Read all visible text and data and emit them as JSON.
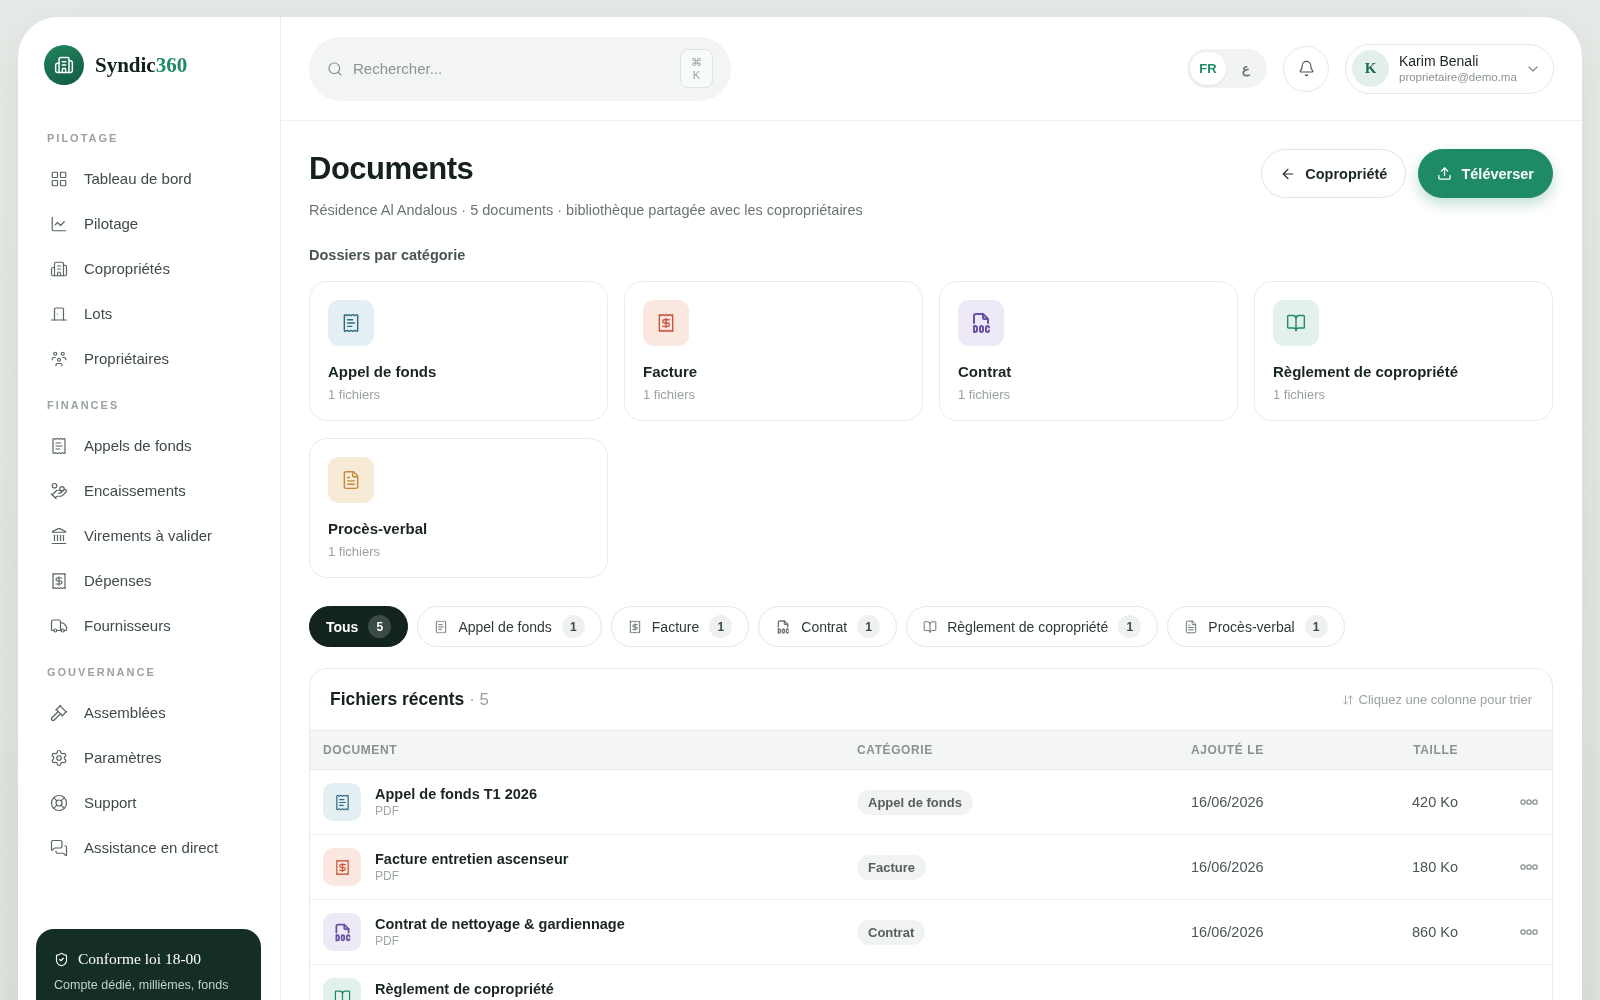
{
  "brand": {
    "name": "Syndic",
    "suffix": "360"
  },
  "sidebar": {
    "sections": [
      {
        "label": "PILOTAGE",
        "items": [
          {
            "label": "Tableau de bord"
          },
          {
            "label": "Pilotage"
          },
          {
            "label": "Copropriétés"
          },
          {
            "label": "Lots"
          },
          {
            "label": "Propriétaires"
          }
        ]
      },
      {
        "label": "FINANCES",
        "items": [
          {
            "label": "Appels de fonds"
          },
          {
            "label": "Encaissements"
          },
          {
            "label": "Virements à valider"
          },
          {
            "label": "Dépenses"
          },
          {
            "label": "Fournisseurs"
          }
        ]
      },
      {
        "label": "GOUVERNANCE",
        "items": [
          {
            "label": "Assemblées"
          },
          {
            "label": "Paramètres"
          },
          {
            "label": "Support"
          },
          {
            "label": "Assistance en direct"
          }
        ]
      }
    ]
  },
  "compliance_card": {
    "title": "Conforme loi 18-00",
    "text": "Compte dédié, millièmes, fonds"
  },
  "search": {
    "placeholder": "Rechercher...",
    "shortcut": [
      "⌘",
      "K"
    ]
  },
  "languages": [
    {
      "label": "FR",
      "selected": true
    },
    {
      "label": "ع",
      "selected": false
    }
  ],
  "user": {
    "initial": "K",
    "name": "Karim Benali",
    "email": "proprietaire@demo.ma"
  },
  "header": {
    "title": "Documents",
    "subtitle": "Résidence Al Andalous · 5 documents · bibliothèque partagée avec les copropriétaires",
    "buttons": [
      {
        "kind": "secondary",
        "label": "Copropriété"
      },
      {
        "kind": "primary",
        "label": "Téléverser"
      }
    ]
  },
  "folders": {
    "title": "Dossiers par catégorie",
    "items": [
      {
        "kind": "funds",
        "name": "Appel de fonds",
        "count": "1 fichiers"
      },
      {
        "kind": "invoice",
        "name": "Facture",
        "count": "1 fichiers"
      },
      {
        "kind": "contract",
        "name": "Contrat",
        "count": "1 fichiers"
      },
      {
        "kind": "rules",
        "name": "Règlement de copropriété",
        "count": "1 fichiers"
      },
      {
        "kind": "minutes",
        "name": "Procès-verbal",
        "count": "1 fichiers"
      }
    ]
  },
  "filters": [
    {
      "kind": "all",
      "label": "Tous",
      "count": "5",
      "selected": true
    },
    {
      "kind": "funds",
      "label": "Appel de fonds",
      "count": "1",
      "selected": false
    },
    {
      "kind": "invoice",
      "label": "Facture",
      "count": "1",
      "selected": false
    },
    {
      "kind": "contract",
      "label": "Contrat",
      "count": "1",
      "selected": false
    },
    {
      "kind": "rules",
      "label": "Règlement de copropriété",
      "count": "1",
      "selected": false
    },
    {
      "kind": "minutes",
      "label": "Procès-verbal",
      "count": "1",
      "selected": false
    }
  ],
  "table": {
    "title": "Fichiers récents",
    "count": "· 5",
    "sort_hint": "Cliquez une colonne pour trier",
    "columns": [
      "DOCUMENT",
      "CATÉGORIE",
      "AJOUTÉ LE",
      "TAILLE"
    ],
    "rows": [
      {
        "kind": "funds",
        "name": "Appel de fonds T1 2026",
        "type": "PDF",
        "category": "Appel de fonds",
        "date": "16/06/2026",
        "size": "420 Ko"
      },
      {
        "kind": "invoice",
        "name": "Facture entretien ascenseur",
        "type": "PDF",
        "category": "Facture",
        "date": "16/06/2026",
        "size": "180 Ko"
      },
      {
        "kind": "contract",
        "name": "Contrat de nettoyage & gardiennage",
        "type": "PDF",
        "category": "Contrat",
        "date": "16/06/2026",
        "size": "860 Ko"
      },
      {
        "kind": "rules",
        "name": "Règlement de copropriété"
      }
    ]
  }
}
